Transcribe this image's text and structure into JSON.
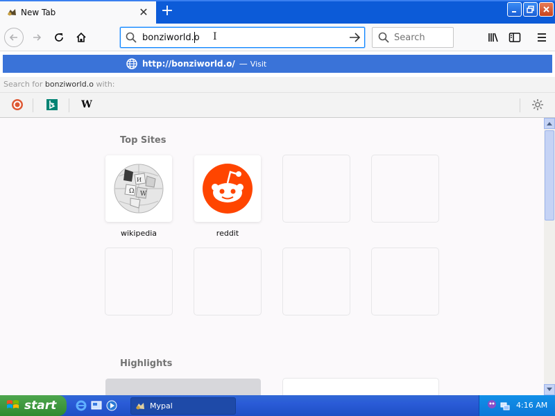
{
  "window": {
    "tab_title": "New Tab",
    "new_tab_symbol": "+",
    "buttons": [
      "minimize",
      "maximize",
      "close"
    ]
  },
  "navbar": {
    "url_value": "bonziworld.o",
    "search_placeholder": "Search"
  },
  "autocomplete": {
    "url": "http://bonziworld.o/",
    "separator": "—",
    "action": "Visit",
    "search_for_prefix": "Search for",
    "search_term": "bonziworld.o",
    "search_suffix": "with:",
    "engines": [
      "duckduckgo-icon",
      "bing-icon",
      "wikipedia-icon"
    ],
    "wikipedia_glyph": "W"
  },
  "content": {
    "top_sites_title": "Top Sites",
    "tiles": [
      {
        "label": "wikipedia",
        "icon": "wikipedia-globe-icon"
      },
      {
        "label": "reddit",
        "icon": "reddit-icon"
      }
    ],
    "highlights_title": "Highlights"
  },
  "taskbar": {
    "start_label": "start",
    "task_label": "Mypal",
    "clock": "4:16 AM"
  },
  "colors": {
    "accent": "#0a84ff",
    "visit_row": "#3a73d8",
    "reddit": "#ff4500",
    "taskbar": "#2a5bd7",
    "start": "#3c9a3c"
  }
}
